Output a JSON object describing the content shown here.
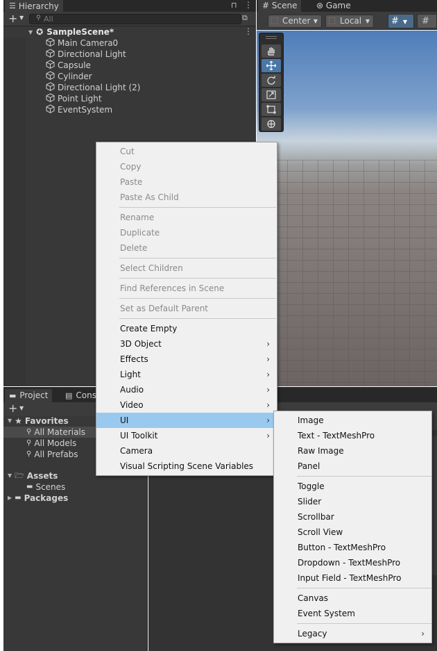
{
  "hierarchy": {
    "tab_label": "Hierarchy",
    "search_placeholder": "All",
    "scene_name": "SampleScene*",
    "items": [
      "Main Camera0",
      "Directional Light",
      "Capsule",
      "Cylinder",
      "Directional Light (2)",
      "Point Light",
      "EventSystem"
    ]
  },
  "scene": {
    "tabs": [
      "Scene",
      "Game"
    ],
    "pivot_label": "Center",
    "space_label": "Local"
  },
  "project": {
    "tabs": [
      "Project",
      "Cons"
    ],
    "favorites_label": "Favorites",
    "favorites": [
      "All Materials",
      "All Models",
      "All Prefabs"
    ],
    "assets_label": "Assets",
    "assets_children": [
      "Scenes"
    ],
    "packages_label": "Packages"
  },
  "context_menu": {
    "groups": [
      [
        {
          "label": "Cut",
          "enabled": false
        },
        {
          "label": "Copy",
          "enabled": false
        },
        {
          "label": "Paste",
          "enabled": false
        },
        {
          "label": "Paste As Child",
          "enabled": false
        }
      ],
      [
        {
          "label": "Rename",
          "enabled": false
        },
        {
          "label": "Duplicate",
          "enabled": false
        },
        {
          "label": "Delete",
          "enabled": false
        }
      ],
      [
        {
          "label": "Select Children",
          "enabled": false
        }
      ],
      [
        {
          "label": "Find References in Scene",
          "enabled": false
        }
      ],
      [
        {
          "label": "Set as Default Parent",
          "enabled": false
        }
      ],
      [
        {
          "label": "Create Empty",
          "enabled": true
        },
        {
          "label": "3D Object",
          "enabled": true,
          "submenu": true
        },
        {
          "label": "Effects",
          "enabled": true,
          "submenu": true
        },
        {
          "label": "Light",
          "enabled": true,
          "submenu": true
        },
        {
          "label": "Audio",
          "enabled": true,
          "submenu": true
        },
        {
          "label": "Video",
          "enabled": true,
          "submenu": true
        },
        {
          "label": "UI",
          "enabled": true,
          "submenu": true,
          "highlighted": true
        },
        {
          "label": "UI Toolkit",
          "enabled": true,
          "submenu": true
        },
        {
          "label": "Camera",
          "enabled": true
        },
        {
          "label": "Visual Scripting Scene Variables",
          "enabled": true
        }
      ]
    ]
  },
  "ui_submenu": {
    "groups": [
      [
        {
          "label": "Image"
        },
        {
          "label": "Text - TextMeshPro"
        },
        {
          "label": "Raw Image"
        },
        {
          "label": "Panel"
        }
      ],
      [
        {
          "label": "Toggle"
        },
        {
          "label": "Slider"
        },
        {
          "label": "Scrollbar"
        },
        {
          "label": "Scroll View"
        },
        {
          "label": "Button - TextMeshPro"
        },
        {
          "label": "Dropdown - TextMeshPro"
        },
        {
          "label": "Input Field - TextMeshPro"
        }
      ],
      [
        {
          "label": "Canvas"
        },
        {
          "label": "Event System"
        }
      ],
      [
        {
          "label": "Legacy",
          "submenu": true
        }
      ]
    ]
  },
  "colors": {
    "menu_bg": "#f0f0f0",
    "menu_highlight": "#99c9ef",
    "menu_disabled_text": "#8a8a8a",
    "panel_bg": "#383838"
  }
}
